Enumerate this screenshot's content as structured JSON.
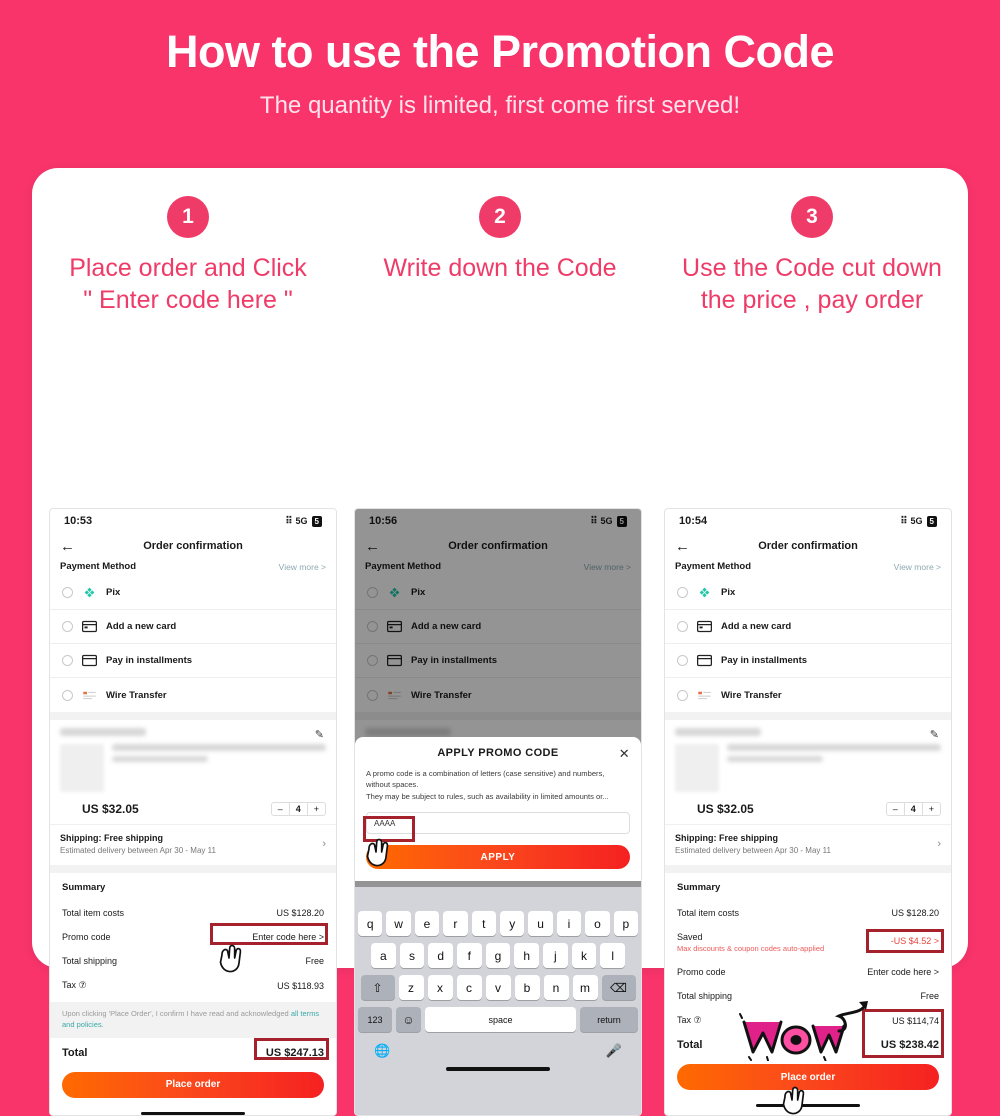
{
  "hero": {
    "title": "How to use the Promotion Code",
    "subtitle": "The quantity is limited, first come first served!",
    "bg_color": "#f8346b"
  },
  "steps": [
    {
      "number": "1",
      "title": "Place order and Click\n\" Enter code here \""
    },
    {
      "number": "2",
      "title": "Write down the Code"
    },
    {
      "number": "3",
      "title": "Use the Code cut down\nthe price , pay order"
    }
  ],
  "common": {
    "nav_title": "Order confirmation",
    "back_icon": "back-arrow-icon",
    "network": "5G",
    "battery": "5",
    "payment_section_label": "Payment Method",
    "view_more": "View more >",
    "payment_methods": [
      {
        "label": "Pix",
        "icon": "pix-icon"
      },
      {
        "label": "Add a new card",
        "icon": "credit-card-icon"
      },
      {
        "label": "Pay in installments",
        "icon": "credit-card-icon"
      },
      {
        "label": "Wire Transfer",
        "icon": "wire-transfer-icon"
      }
    ],
    "product": {
      "price": "US $32.05",
      "qty": "4",
      "minus": "–",
      "plus": "+",
      "shipping_title": "Shipping: Free shipping",
      "shipping_sub": "Estimated delivery between Apr 30 - May 11",
      "edit_icon": "pencil-icon",
      "chevron": "›"
    },
    "summary_label": "Summary",
    "terms_text": "Upon clicking 'Place Order', I confirm I have read and acknowledged ",
    "terms_link": "all terms and policies.",
    "total_label": "Total",
    "place_order": "Place order"
  },
  "phone1": {
    "time": "10:53",
    "summary_rows": [
      {
        "label": "Total item costs",
        "value": "US $128.20"
      },
      {
        "label": "Promo code",
        "value": "Enter code here >",
        "highlight": true
      },
      {
        "label": "Total shipping",
        "value": "Free"
      },
      {
        "label": "Tax ⑦",
        "value": "US $118.93"
      }
    ],
    "total_value": "US $247.13"
  },
  "phone2": {
    "time": "10:56",
    "modal": {
      "title": "APPLY PROMO CODE",
      "close_icon": "close-icon",
      "description": "A promo code is a combination of letters (case sensitive) and numbers, without spaces.\nThey may be subject to rules, such as availability in limited amounts or...",
      "input_value": "AAAA",
      "apply_label": "APPLY"
    },
    "keyboard": {
      "row1": [
        "q",
        "w",
        "e",
        "r",
        "t",
        "y",
        "u",
        "i",
        "o",
        "p"
      ],
      "row2": [
        "a",
        "s",
        "d",
        "f",
        "g",
        "h",
        "j",
        "k",
        "l"
      ],
      "row3": [
        "z",
        "x",
        "c",
        "v",
        "b",
        "n",
        "m"
      ],
      "shift_icon": "shift-icon",
      "backspace_icon": "backspace-icon",
      "numbers_key": "123",
      "emoji_icon": "emoji-icon",
      "space_key": "space",
      "return_key": "return",
      "globe_icon": "globe-icon",
      "mic_icon": "microphone-icon"
    }
  },
  "phone3": {
    "time": "10:54",
    "summary_rows": [
      {
        "label": "Total item costs",
        "value": "US $128.20"
      },
      {
        "label": "Saved",
        "sub": "Max discounts & coupon codes auto-applied",
        "value": "-US $4.52 >",
        "highlight": true
      },
      {
        "label": "Promo code",
        "value": "Enter code here >"
      },
      {
        "label": "Total shipping",
        "value": "Free"
      },
      {
        "label": "Tax ⑦",
        "value": "US $114,74",
        "highlight": true
      }
    ],
    "total_value": "US $238.42",
    "sticker": "Wow"
  },
  "colors": {
    "pink": "#f8346b",
    "badge": "#ef3b68",
    "step_title": "#ef3b68",
    "highlight_border": "#a5222d",
    "cta_orange": "#fb4a1b",
    "link_teal": "#3aa8a8"
  }
}
